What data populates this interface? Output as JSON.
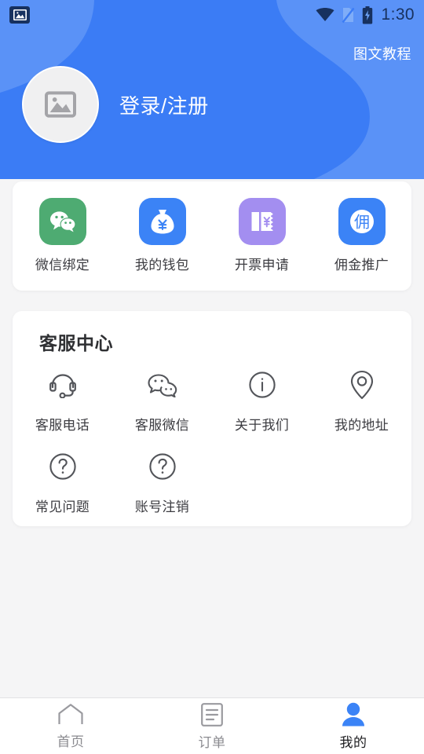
{
  "statusbar": {
    "time": "1:30",
    "icons": [
      "gallery-icon",
      "wifi-icon",
      "sim-off-icon",
      "battery-charging-icon"
    ]
  },
  "header": {
    "tutorial_label": "图文教程",
    "login_label": "登录/注册",
    "avatar_icon": "image-placeholder-icon",
    "bg_color": "#3b7cf5",
    "bg_accent_color": "#5a92f7"
  },
  "quick_actions": {
    "items": [
      {
        "label": "微信绑定",
        "icon": "wechat-icon",
        "color": "#4eab72"
      },
      {
        "label": "我的钱包",
        "icon": "money-bag-icon",
        "color": "#3b83f6"
      },
      {
        "label": "开票申请",
        "icon": "invoice-icon",
        "color": "#a38ef0"
      },
      {
        "label": "佣金推广",
        "icon": "commission-icon",
        "color": "#3b83f6"
      }
    ]
  },
  "service_center": {
    "title": "客服中心",
    "items": [
      {
        "label": "客服电话",
        "icon": "headset-icon"
      },
      {
        "label": "客服微信",
        "icon": "wechat-outline-icon"
      },
      {
        "label": "关于我们",
        "icon": "info-circle-icon"
      },
      {
        "label": "我的地址",
        "icon": "map-pin-icon"
      },
      {
        "label": "常见问题",
        "icon": "question-circle-icon"
      },
      {
        "label": "账号注销",
        "icon": "question-circle-icon"
      }
    ]
  },
  "tabbar": {
    "active_color": "#3b83f6",
    "inactive_color": "#8b8b90",
    "items": [
      {
        "label": "首页",
        "icon": "home-icon",
        "active": false
      },
      {
        "label": "订单",
        "icon": "document-icon",
        "active": false
      },
      {
        "label": "我的",
        "icon": "person-icon",
        "active": true
      }
    ]
  }
}
